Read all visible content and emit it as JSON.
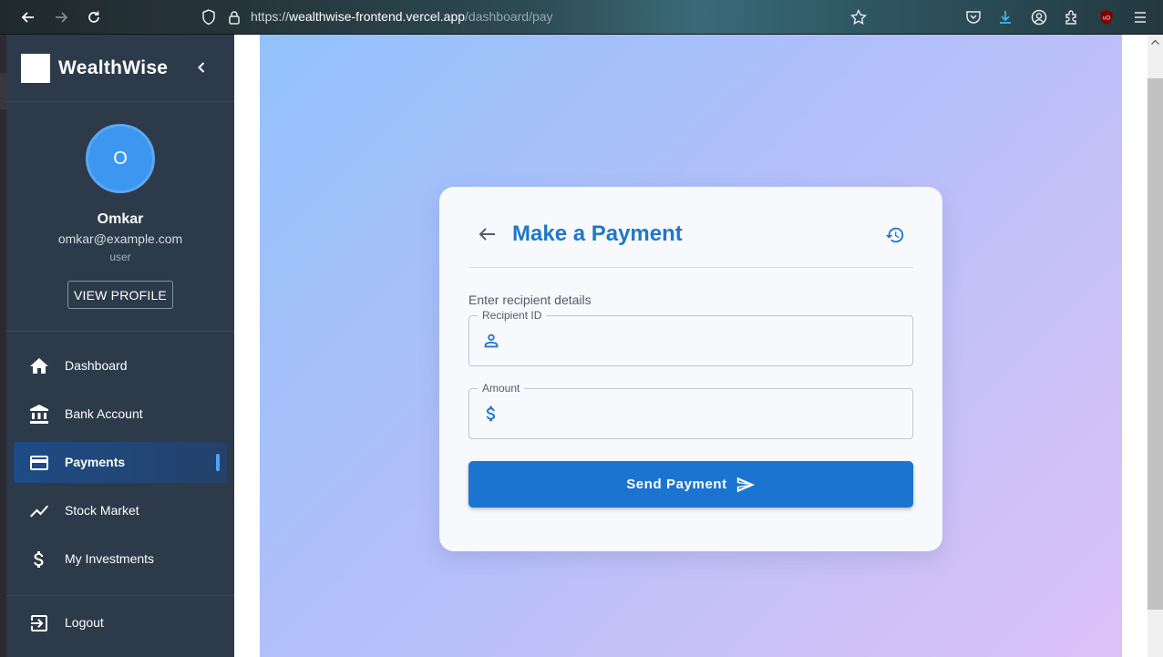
{
  "browser": {
    "url_prefix": "https://",
    "url_domain": "wealthwise-frontend.vercel.app",
    "url_path": "/dashboard/pay"
  },
  "sidebar": {
    "brand_name": "WealthWise",
    "user": {
      "initial": "O",
      "name": "Omkar",
      "email": "omkar@example.com",
      "role": "user"
    },
    "view_profile_label": "VIEW PROFILE",
    "items": [
      {
        "label": "Dashboard",
        "icon": "home-icon"
      },
      {
        "label": "Bank Account",
        "icon": "bank-icon"
      },
      {
        "label": "Payments",
        "icon": "credit-card-icon",
        "active": true
      },
      {
        "label": "Stock Market",
        "icon": "trending-up-icon"
      },
      {
        "label": "My Investments",
        "icon": "dollar-icon"
      }
    ],
    "logout_label": "Logout"
  },
  "payment_card": {
    "title": "Make a Payment",
    "section_label": "Enter recipient details",
    "recipient_label": "Recipient ID",
    "recipient_value": "",
    "amount_label": "Amount",
    "amount_value": "",
    "send_label": "Send Payment"
  },
  "colors": {
    "sidebar_bg": "#2c3a4a",
    "accent": "#1b75d0",
    "title": "#1f77c9",
    "avatar": "#3d97f0"
  }
}
